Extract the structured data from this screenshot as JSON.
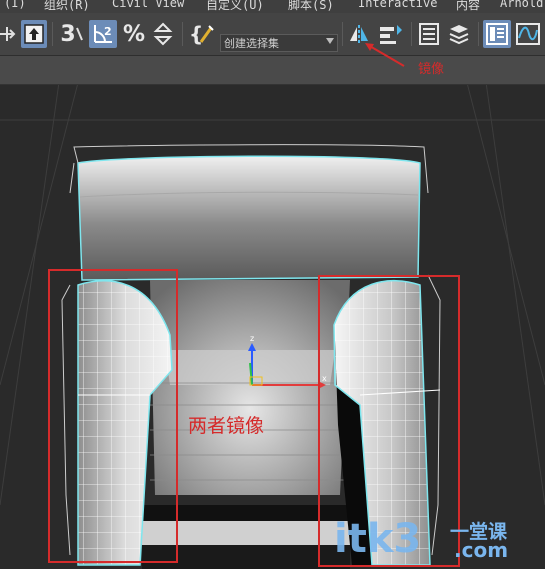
{
  "menubar": {
    "items": [
      "(I)",
      "组织(R)",
      "Civil View",
      "自定义(U)",
      "脚本(S)",
      "Interactive",
      "内容",
      "Arnold"
    ]
  },
  "toolbar": {
    "icons": [
      "move-icon",
      "select-object-icon",
      "snap-3d-icon",
      "angle-snap-icon",
      "percent-snap-icon",
      "spinner-snap-icon",
      "edit-named-selection-icon",
      "mirror-icon",
      "align-icon",
      "scene-explorer-icon",
      "layer-explorer-icon",
      "ribbon-toggle-icon",
      "curve-editor-icon"
    ],
    "snap_label": "3",
    "angle_label": "2",
    "percent_label": "%",
    "selection_set_placeholder": "创建选择集"
  },
  "annotations": {
    "mirror_label": "镜像",
    "both_mirrored_label": "两者镜像"
  },
  "watermark": {
    "main": "itk3",
    "sub": "一堂课",
    "domain": ".com"
  },
  "colors": {
    "annotation": "#d52b2b",
    "selection_wire": "#7fe6ee",
    "toolbar_active": "#6c8cb8",
    "watermark": "#7ab6ee"
  }
}
